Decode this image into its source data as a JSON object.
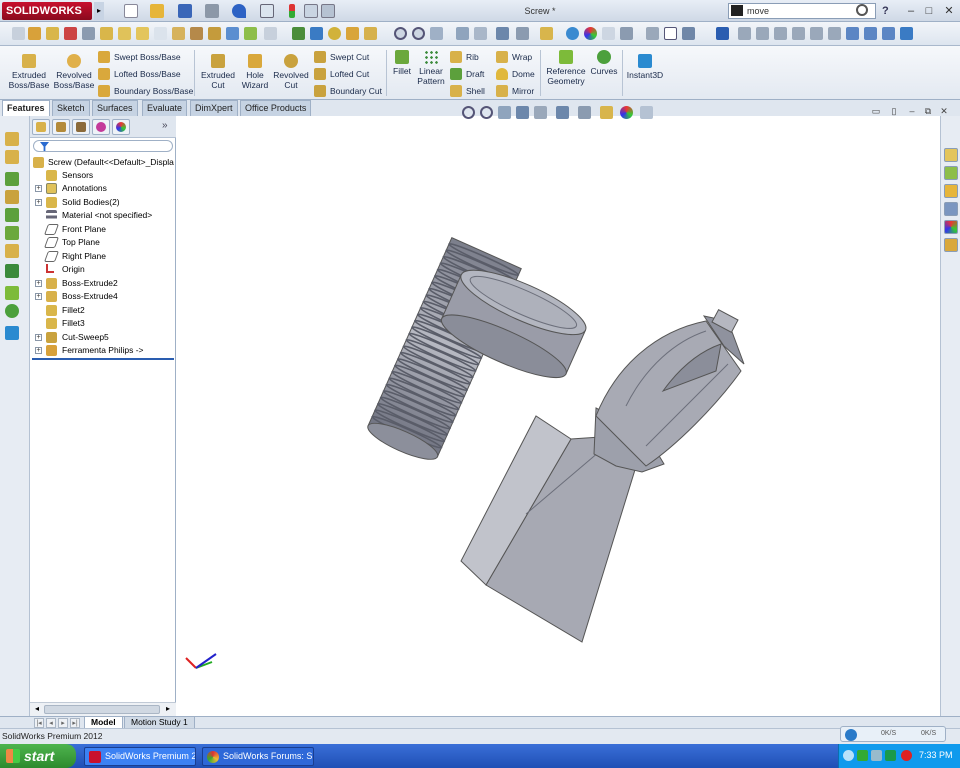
{
  "app": {
    "brand": "SOLIDWORKS",
    "doc_title": "Screw *",
    "search_value": "move"
  },
  "commands": {
    "extruded_boss": "Extruded Boss/Base",
    "revolved_boss": "Revolved Boss/Base",
    "swept_boss": "Swept Boss/Base",
    "lofted_boss": "Lofted Boss/Base",
    "boundary_boss": "Boundary Boss/Base",
    "extruded_cut": "Extruded Cut",
    "hole_wizard": "Hole Wizard",
    "revolved_cut": "Revolved Cut",
    "swept_cut": "Swept Cut",
    "lofted_cut": "Lofted Cut",
    "boundary_cut": "Boundary Cut",
    "fillet": "Fillet",
    "linear_pattern": "Linear Pattern",
    "rib": "Rib",
    "draft": "Draft",
    "shell": "Shell",
    "wrap": "Wrap",
    "dome": "Dome",
    "mirror": "Mirror",
    "reference_geometry": "Reference Geometry",
    "curves": "Curves",
    "instant3d": "Instant3D"
  },
  "tabs": [
    "Features",
    "Sketch",
    "Surfaces",
    "Evaluate",
    "DimXpert",
    "Office Products"
  ],
  "tree": {
    "root": "Screw  (Default<<Default>_Displa",
    "items": [
      {
        "label": "Sensors"
      },
      {
        "label": "Annotations"
      },
      {
        "label": "Solid Bodies(2)"
      },
      {
        "label": "Material <not specified>"
      },
      {
        "label": "Front Plane"
      },
      {
        "label": "Top Plane"
      },
      {
        "label": "Right Plane"
      },
      {
        "label": "Origin"
      },
      {
        "label": "Boss-Extrude2"
      },
      {
        "label": "Boss-Extrude4"
      },
      {
        "label": "Fillet2"
      },
      {
        "label": "Fillet3"
      },
      {
        "label": "Cut-Sweep5"
      },
      {
        "label": "Ferramenta Philips ->"
      }
    ]
  },
  "bottom_tabs": [
    "Model",
    "Motion Study 1"
  ],
  "status": {
    "text": "SolidWorks Premium 2012",
    "net_up": "0K/S",
    "net_down": "0K/S"
  },
  "taskbar": {
    "start": "start",
    "task1": "SolidWorks Premium 2...",
    "task2": "SolidWorks Forums: S...",
    "clock": "7:33 PM"
  },
  "colors": {
    "brand_red": "#c8102e",
    "part_gray": "#a9abb4",
    "taskbar_blue": "#2558c4"
  }
}
